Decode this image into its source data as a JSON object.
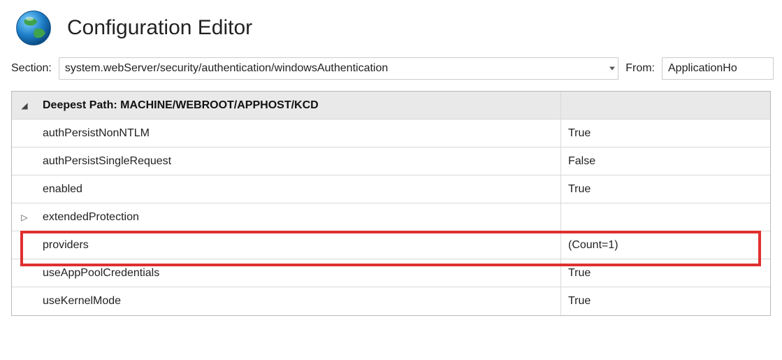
{
  "header": {
    "title": "Configuration Editor"
  },
  "selectors": {
    "sectionLabel": "Section:",
    "sectionValue": "system.webServer/security/authentication/windowsAuthentication",
    "fromLabel": "From:",
    "fromValue": "ApplicationHo"
  },
  "grid": {
    "headerPrefix": "Deepest Path: ",
    "headerPath": "MACHINE/WEBROOT/APPHOST/KCD",
    "rows": [
      {
        "name": "authPersistNonNTLM",
        "value": "True",
        "expandable": false
      },
      {
        "name": "authPersistSingleRequest",
        "value": "False",
        "expandable": false
      },
      {
        "name": "enabled",
        "value": "True",
        "expandable": false
      },
      {
        "name": "extendedProtection",
        "value": "",
        "expandable": true
      },
      {
        "name": "providers",
        "value": "(Count=1)",
        "expandable": false
      },
      {
        "name": "useAppPoolCredentials",
        "value": "True",
        "expandable": false
      },
      {
        "name": "useKernelMode",
        "value": "True",
        "expandable": false
      }
    ]
  }
}
